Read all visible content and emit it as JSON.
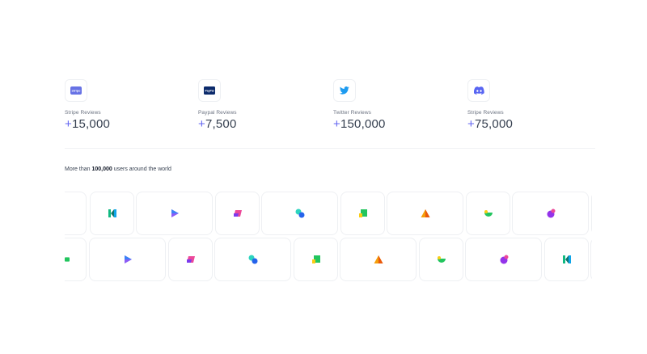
{
  "stats": [
    {
      "icon": "stripe-logo-icon",
      "brand_text": "stripe",
      "label": "Stripe Reviews",
      "plus": "+",
      "value": "15,000"
    },
    {
      "icon": "paypal-logo-icon",
      "brand_text": "PayPal",
      "label": "Paypal Reviews",
      "plus": "+",
      "value": "7,500"
    },
    {
      "icon": "twitter-logo-icon",
      "label": "Twitter Reviews",
      "plus": "+",
      "value": "150,000"
    },
    {
      "icon": "discord-logo-icon",
      "label": "Stripe Reviews",
      "plus": "+",
      "value": "75,000"
    }
  ],
  "users_line": {
    "prefix": "More than ",
    "count": "100,000",
    "suffix": " users around the world"
  },
  "logo_rows": [
    [
      "green-bars-logo-icon",
      "teal-k-logo-icon",
      "play-triangle-logo-icon",
      "pink-fold-logo-icon",
      "overlapping-circles-logo-icon",
      "green-square-logo-icon",
      "orange-triangle-logo-icon",
      "green-bowl-logo-icon",
      "purple-blob-logo-icon",
      "partial-logo-icon"
    ],
    [
      "green-bars-logo-icon",
      "play-triangle-logo-icon",
      "pink-fold-logo-icon",
      "overlapping-circles-logo-icon",
      "green-square-logo-icon",
      "orange-triangle-logo-icon",
      "green-bowl-logo-icon",
      "purple-blob-logo-icon",
      "teal-k-logo-icon",
      "partial-logo-icon"
    ]
  ]
}
